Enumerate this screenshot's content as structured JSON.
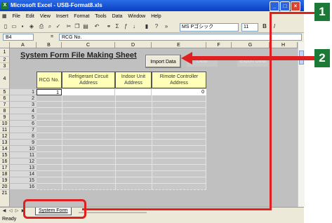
{
  "window": {
    "title": "Microsoft Excel - USB-Format8.xls"
  },
  "menu": [
    "File",
    "Edit",
    "View",
    "Insert",
    "Format",
    "Tools",
    "Data",
    "Window",
    "Help"
  ],
  "toolbar": {
    "font_name": "MS Pゴシック",
    "font_size": "11",
    "zoom_chevron": "»"
  },
  "formula_bar": {
    "cell_ref": "B4",
    "fx": "=",
    "value": "RCG No."
  },
  "columns": [
    "A",
    "B",
    "C",
    "D",
    "E",
    "F",
    "G",
    "H"
  ],
  "rows": [
    "1",
    "2",
    "3",
    "4",
    "5",
    "6",
    "7",
    "8",
    "9",
    "10",
    "11",
    "12",
    "13",
    "14",
    "15",
    "16",
    "17",
    "18",
    "19",
    "20",
    "21"
  ],
  "sheet": {
    "title": "System Form File Making Sheet",
    "import_button": "Import Data",
    "hidden_button_1": "Clear",
    "hidden_button_2": "Export Data",
    "headers": [
      "RCG No.",
      "Refrigerant Circuit Address",
      "Indoor Unit Address",
      "Rimote Controller Address"
    ],
    "row_numbers": [
      "1",
      "2",
      "3",
      "4",
      "5",
      "6",
      "7",
      "8",
      "9",
      "10",
      "11",
      "12",
      "13",
      "14",
      "15",
      "16"
    ],
    "first_row_rcg": "1",
    "first_row_rc": "0"
  },
  "tabs": {
    "active": "System Form"
  },
  "status": "Ready",
  "callouts": [
    "1",
    "2"
  ],
  "colors": {
    "accent_red": "#e02020",
    "callout_green": "#1c7a36",
    "header_yellow": "#ffffb8"
  }
}
